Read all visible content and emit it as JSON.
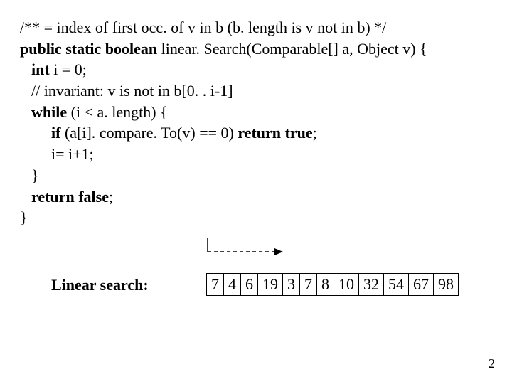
{
  "code": {
    "l1": "/** = index of first occ. of v in b (b. length is v not in b) */",
    "l2_a": "public static boolean",
    "l2_b": " linear. Search(Comparable[] a, Object v) {",
    "l3_a": "int",
    "l3_b": " i = 0;",
    "l4": "// invariant: v is not in b[0. . i-1]",
    "l5_a": "while",
    "l5_b": " (i < a. length) {",
    "l6_a": "if",
    "l6_b": " (a[i]. compare. To(v) == 0) ",
    "l6_c": "return true",
    "l6_d": ";",
    "l7": "i= i+1;",
    "l8": "}",
    "l9_a": "return false",
    "l9_b": ";",
    "l10": "}"
  },
  "label": "Linear search:",
  "array": [
    "7",
    "4",
    "6",
    "19",
    "3",
    "7",
    "8",
    "10",
    "32",
    "54",
    "67",
    "98"
  ],
  "page": "2"
}
